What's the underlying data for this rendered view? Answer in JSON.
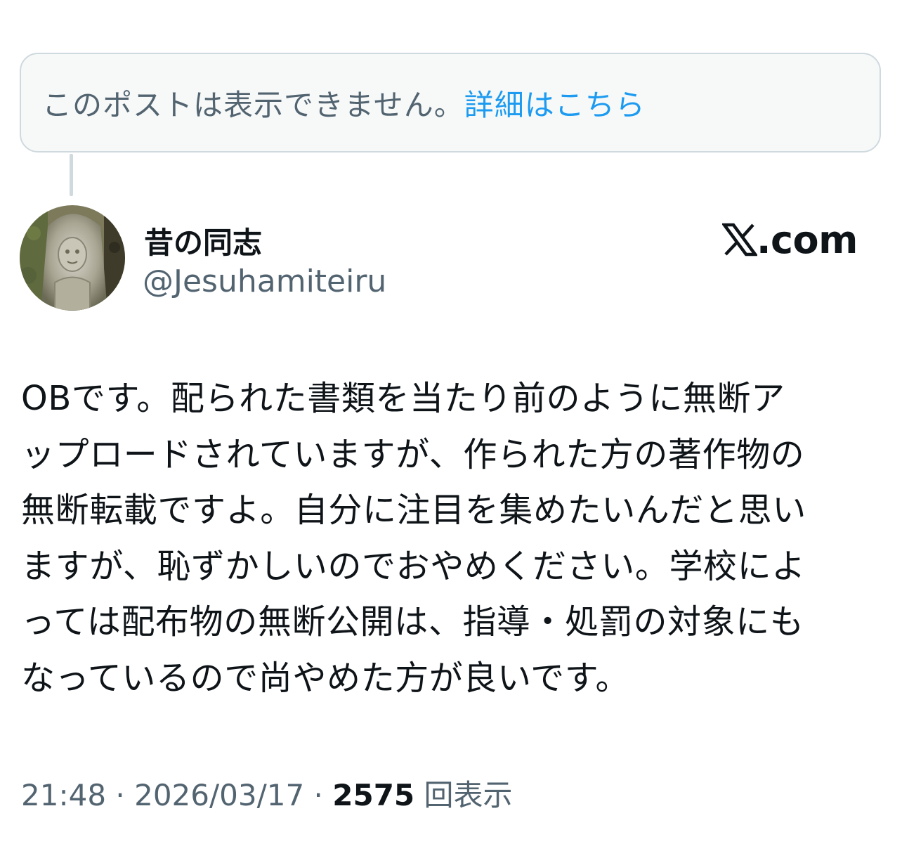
{
  "unavailable_notice": {
    "text": "このポストは表示できません。",
    "link_label": "詳細はこちら"
  },
  "author": {
    "display_name": "昔の同志",
    "handle": "@Jesuhamiteiru"
  },
  "brand": {
    "label": ".com",
    "icon": "x-logo-icon"
  },
  "post": {
    "lines": [
      "OBです。配られた書類を当たり前のように無断ア",
      "ップロードされていますが、作られた方の著作物の",
      "無断転載ですよ。自分に注目を集めたいんだと思い",
      "ますが、恥ずかしいのでおやめください。学校によ",
      "っては配布物の無断公開は、指導・処罰の対象にも",
      "なっているので尚やめた方が良いです。"
    ]
  },
  "meta": {
    "time": "21:48",
    "separator": " · ",
    "date": "2026/03/17",
    "views_count": "2575",
    "views_label": "回表示"
  },
  "colors": {
    "text_primary": "#0f1419",
    "text_secondary": "#536471",
    "link": "#1d9bf0",
    "border": "#cfd9de",
    "notice_bg": "#f7f9f9"
  }
}
